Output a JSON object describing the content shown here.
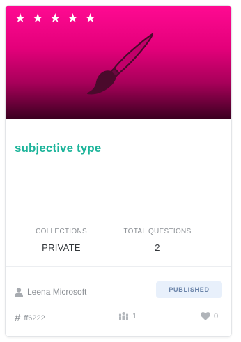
{
  "card": {
    "rating": {
      "stars": 5
    },
    "title": "subjective type",
    "stats": {
      "collections_label": "COLLECTIONS",
      "collections_value": "PRIVATE",
      "questions_label": "TOTAL QUESTIONS",
      "questions_value": "2"
    },
    "author": "Leena Microsoft",
    "status": "PUBLISHED",
    "color_code": "ff6222",
    "members": "1",
    "likes": "0",
    "colors": {
      "banner_top": "#ff0a92",
      "banner_bottom": "#3a0020",
      "title": "#1cb49a",
      "badge_bg": "#e8f0fb"
    },
    "icons": [
      "star-icon",
      "paintbrush-icon",
      "user-icon",
      "hash-icon",
      "people-icon",
      "heart-icon"
    ]
  }
}
